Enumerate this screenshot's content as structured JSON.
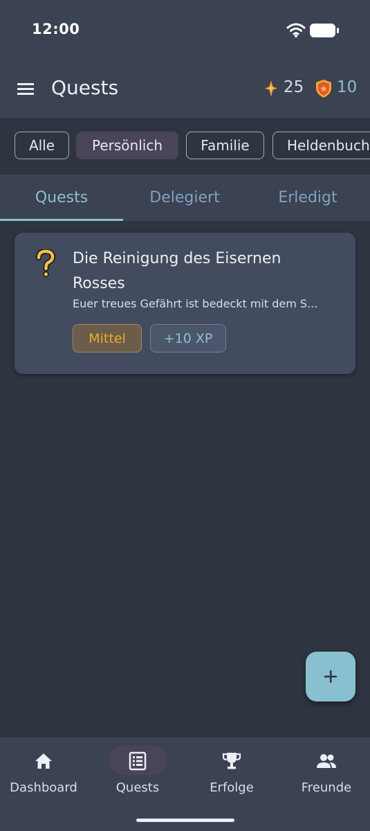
{
  "status_bar": {
    "time": "12:00"
  },
  "app_bar": {
    "title": "Quests",
    "star_count": "25",
    "shield_count": "10"
  },
  "filters": [
    {
      "label": "Alle",
      "selected": false
    },
    {
      "label": "Persönlich",
      "selected": true
    },
    {
      "label": "Familie",
      "selected": false
    },
    {
      "label": "Heldenbuch",
      "selected": false
    }
  ],
  "tabs": [
    {
      "label": "Quests",
      "active": true
    },
    {
      "label": "Delegiert",
      "active": false
    },
    {
      "label": "Erledigt",
      "active": false
    }
  ],
  "quests": [
    {
      "icon": "question-icon",
      "title": "Die Reinigung des Eisernen Rosses",
      "description": "Euer treues Gefährt ist bedeckt mit dem S...",
      "difficulty": "Mittel",
      "xp": "+10 XP"
    }
  ],
  "bottom_nav": [
    {
      "label": "Dashboard",
      "icon": "home-icon",
      "active": false
    },
    {
      "label": "Quests",
      "icon": "list-icon",
      "active": true
    },
    {
      "label": "Erfolge",
      "icon": "trophy-icon",
      "active": false
    },
    {
      "label": "Freunde",
      "icon": "people-icon",
      "active": false
    }
  ],
  "colors": {
    "background": "#2e3440",
    "surface": "#3b4252",
    "card": "#434c5e",
    "accent": "#88c0d0",
    "selected_chip": "#4a4458",
    "difficulty_text": "#f0a92e"
  }
}
